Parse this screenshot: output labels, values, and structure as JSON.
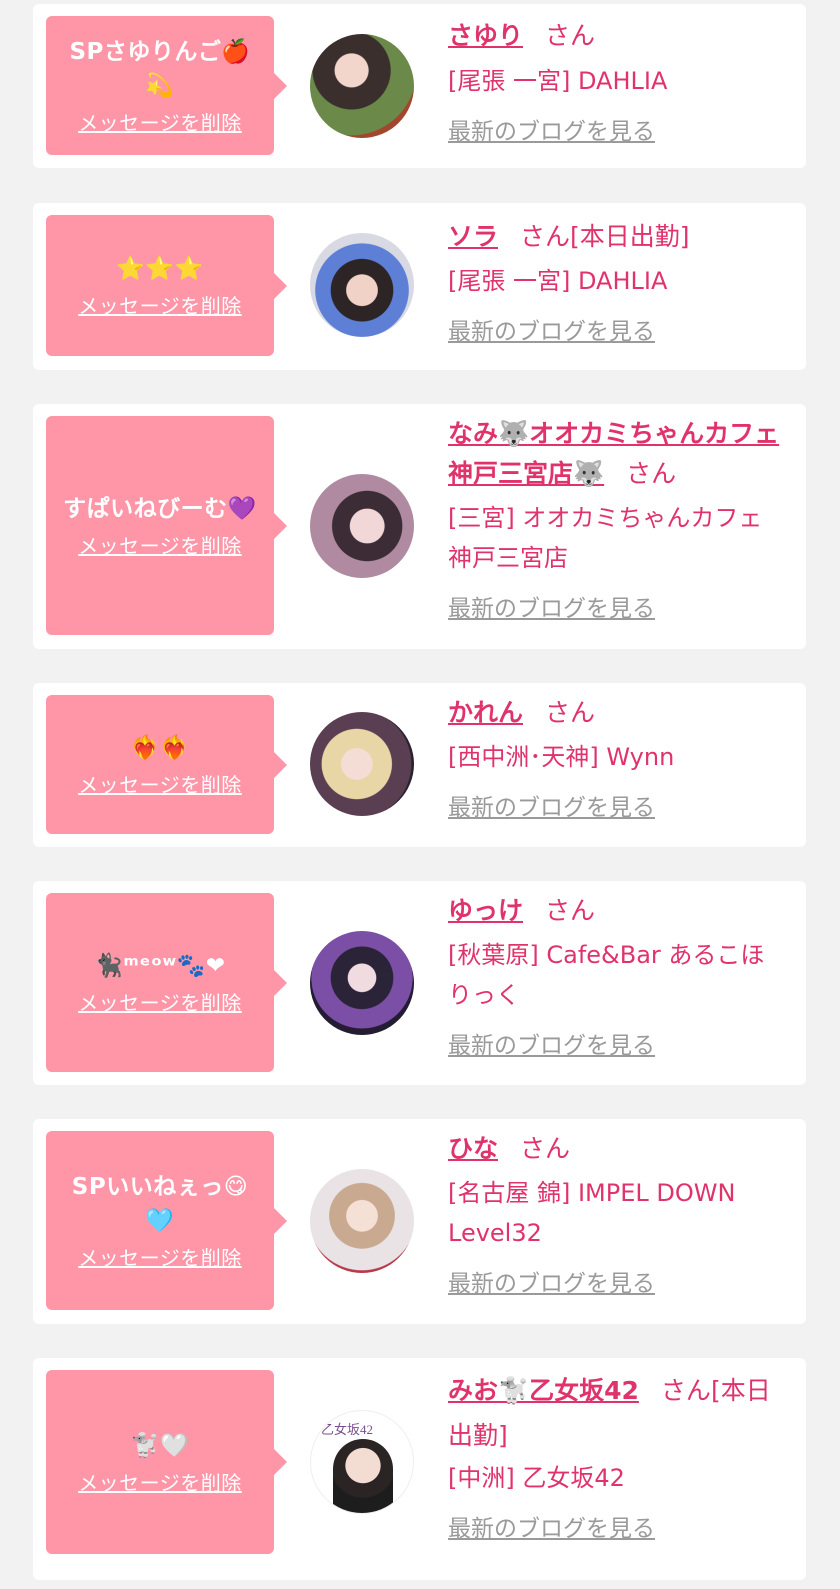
{
  "san_label": "さん",
  "delete_label": "メッセージを削除",
  "blog_label": "最新のブログを見る",
  "colors": {
    "accent": "#e0336b",
    "bubble": "#ff96a8",
    "background": "#f2f2f2",
    "link_gray": "#9a9a9a"
  },
  "entries": [
    {
      "message": "SPさゆりんご🍎💫",
      "name": "さゆり",
      "status": "",
      "shop": "[尾張 一宮] DAHLIA"
    },
    {
      "message": "⭐️⭐️⭐️",
      "name": "ソラ",
      "status": "[本日出勤]",
      "shop": "[尾張 一宮] DAHLIA"
    },
    {
      "message": "すぱいねびーむ💜",
      "name": "なみ🐺オオカミちゃんカフェ神戸三宮店🐺",
      "status": "",
      "shop": "[三宮] オオカミちゃんカフェ神戸三宮店"
    },
    {
      "message": "❤️‍🔥❤️‍🔥",
      "name": "かれん",
      "status": "",
      "shop": "[西中洲･天神] Wynn"
    },
    {
      "message": "🐈‍⬛ᵐᵉᵒʷ🐾❤",
      "name": "ゆっけ",
      "status": "",
      "shop": "[秋葉原] Cafe&Bar あるこほりっく"
    },
    {
      "message": "SPいいねぇっ😋🩵",
      "name": "ひな",
      "status": "",
      "shop": "[名古屋 錦] IMPEL DOWN Level32"
    },
    {
      "message": "🐩🤍",
      "name": "みお🐩乙女坂42",
      "status": "[本日出勤]",
      "shop": "[中洲] 乙女坂42",
      "avatar_text": "乙女坂42"
    }
  ]
}
